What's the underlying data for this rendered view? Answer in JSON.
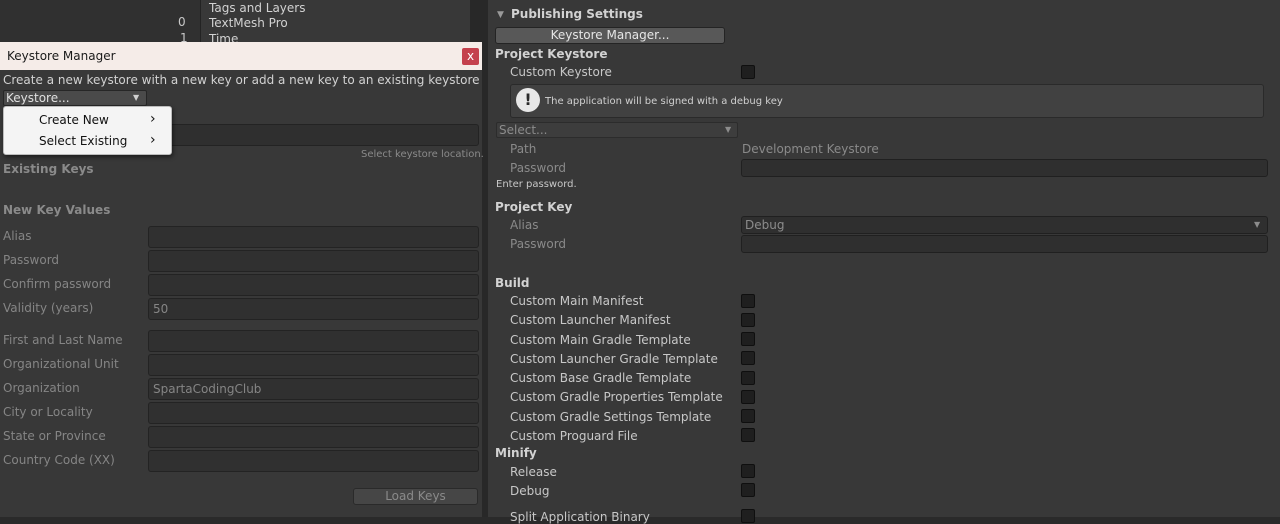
{
  "background_panel": {
    "counter_values": [
      "0",
      "1"
    ],
    "settings_list": [
      "Tags and Layers",
      "TextMesh Pro",
      "Time"
    ]
  },
  "inspector": {
    "section_title": "Publishing Settings",
    "keystore_manager_button": "Keystore Manager...",
    "project_keystore": {
      "heading": "Project Keystore",
      "custom_keystore_label": "Custom Keystore",
      "info_message": "The application will be signed with a debug key",
      "select_dropdown": "Select...",
      "path_label": "Path",
      "path_value": "Development Keystore",
      "password_label": "Password",
      "password_hint": "Enter password."
    },
    "project_key": {
      "heading": "Project Key",
      "alias_label": "Alias",
      "alias_value": "Debug",
      "password_label": "Password"
    },
    "build": {
      "heading": "Build",
      "options": [
        "Custom Main Manifest",
        "Custom Launcher Manifest",
        "Custom Main Gradle Template",
        "Custom Launcher Gradle Template",
        "Custom Base Gradle Template",
        "Custom Gradle Properties Template",
        "Custom Gradle Settings Template",
        "Custom Proguard File"
      ]
    },
    "minify": {
      "heading": "Minify",
      "options": [
        "Release",
        "Debug"
      ]
    },
    "cut_off_option": "Split Application Binary"
  },
  "keystore_window": {
    "title": "Keystore Manager",
    "close_label": "x",
    "instruction": "Create a new keystore with a new key or add a new key to an existing keystore",
    "keystore_dropdown": "Keystore...",
    "location_hint": "Select keystore location.",
    "existing_keys_heading": "Existing Keys",
    "new_key_values_heading": "New Key Values",
    "fields": {
      "alias": {
        "label": "Alias",
        "value": ""
      },
      "password": {
        "label": "Password",
        "value": ""
      },
      "confirm_password": {
        "label": "Confirm password",
        "value": ""
      },
      "validity": {
        "label": "Validity (years)",
        "value": "50"
      },
      "first_last_name": {
        "label": "First and Last Name",
        "value": ""
      },
      "org_unit": {
        "label": "Organizational Unit",
        "value": ""
      },
      "organization": {
        "label": "Organization",
        "value": "SpartaCodingClub"
      },
      "city": {
        "label": "City or Locality",
        "value": ""
      },
      "state": {
        "label": "State or Province",
        "value": ""
      },
      "country": {
        "label": "Country Code (XX)",
        "value": ""
      }
    },
    "load_keys_button": "Load Keys",
    "popup_menu": {
      "items": [
        "Create New",
        "Select Existing"
      ],
      "submenu_glyph": "›"
    }
  }
}
